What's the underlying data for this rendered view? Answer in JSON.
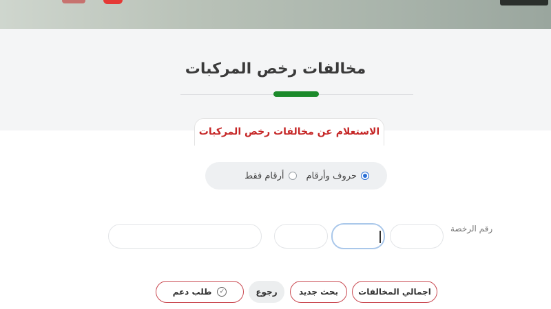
{
  "page": {
    "title": "مخالفات رخص المركبات"
  },
  "inquiry": {
    "title": "الاستعلام عن مخالفات رخص المركبات"
  },
  "radio_options": [
    {
      "label": "حروف وأرقام",
      "checked": true
    },
    {
      "label": "أرقام فقط",
      "checked": false
    }
  ],
  "license": {
    "label": "رقم الرخصة",
    "fields": [
      "",
      "",
      "",
      ""
    ]
  },
  "buttons": {
    "total_violations": "اجمالي المخالفات",
    "new_search": "بحث جديد",
    "back": "رجوع",
    "support_request": "طلب دعم"
  },
  "colors": {
    "accent_red": "#c62828",
    "accent_green": "#1b8a2a",
    "radio_blue": "#2a6fd6"
  }
}
